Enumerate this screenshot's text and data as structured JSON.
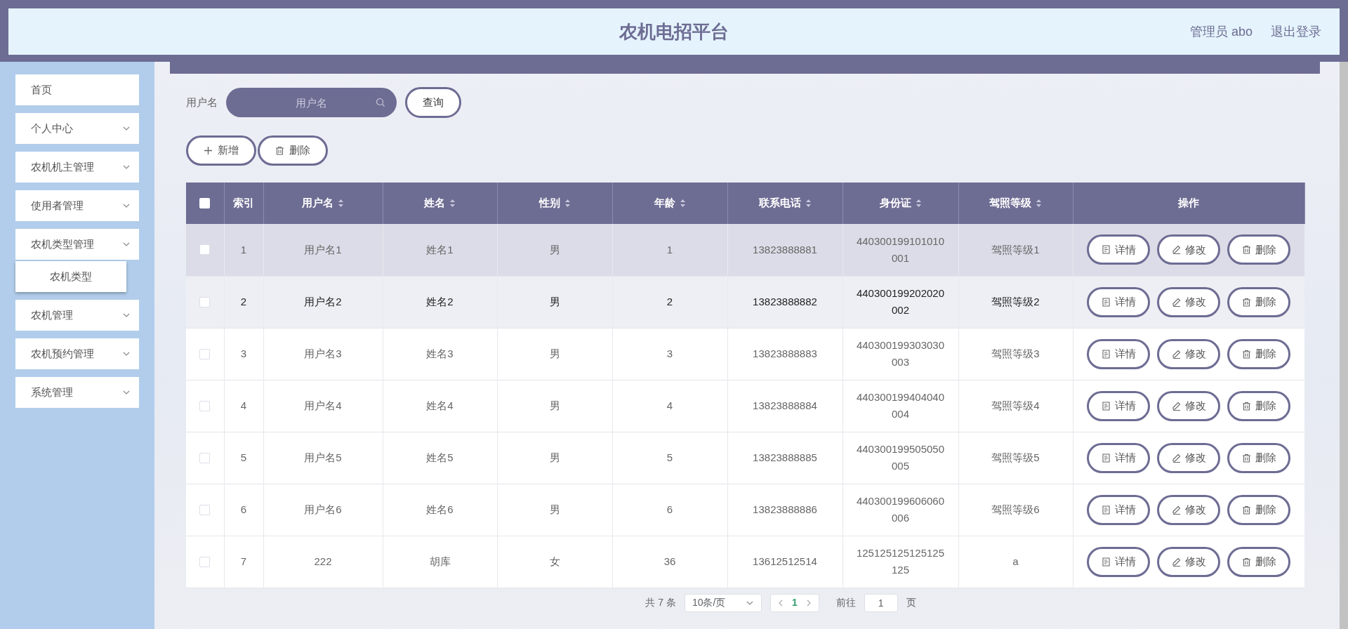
{
  "header": {
    "title": "农机电招平台",
    "user": "管理员 abo",
    "logout": "退出登录"
  },
  "sidebar": {
    "items": [
      {
        "label": "首页",
        "kind": "link"
      },
      {
        "label": "个人中心",
        "kind": "menu"
      },
      {
        "label": "农机机主管理",
        "kind": "menu"
      },
      {
        "label": "使用者管理",
        "kind": "menu"
      },
      {
        "label": "农机类型管理",
        "kind": "menu",
        "children": [
          {
            "label": "农机类型"
          }
        ]
      },
      {
        "label": "农机管理",
        "kind": "menu"
      },
      {
        "label": "农机预约管理",
        "kind": "menu"
      },
      {
        "label": "系统管理",
        "kind": "menu"
      }
    ]
  },
  "search": {
    "label": "用户名",
    "placeholder": "用户名",
    "button": "查询"
  },
  "actions": [
    {
      "label": "新增",
      "kind": "add"
    },
    {
      "label": "删除",
      "kind": "delete"
    }
  ],
  "table": {
    "columns": [
      {
        "label": "索引",
        "sortable": false
      },
      {
        "label": "用户名",
        "sortable": true
      },
      {
        "label": "姓名",
        "sortable": true
      },
      {
        "label": "性别",
        "sortable": true
      },
      {
        "label": "年龄",
        "sortable": true
      },
      {
        "label": "联系电话",
        "sortable": true
      },
      {
        "label": "身份证",
        "sortable": true
      },
      {
        "label": "驾照等级",
        "sortable": true
      },
      {
        "label": "操作",
        "sortable": false
      }
    ],
    "all_checked": false,
    "rows": [
      {
        "selected": true,
        "hovered": false,
        "checked": false,
        "cells": [
          "1",
          "用户名1",
          "姓名1",
          "男",
          "1",
          "13823888881",
          "440300199101010001",
          "驾照等级1"
        ],
        "actions": [
          {
            "label": "详情",
            "kind": "detail"
          },
          {
            "label": "修改",
            "kind": "edit"
          },
          {
            "label": "删除",
            "kind": "delete"
          }
        ]
      },
      {
        "selected": false,
        "hovered": true,
        "checked": false,
        "cells": [
          "2",
          "用户名2",
          "姓名2",
          "男",
          "2",
          "13823888882",
          "440300199202020002",
          "驾照等级2"
        ],
        "actions": [
          {
            "label": "详情",
            "kind": "detail"
          },
          {
            "label": "修改",
            "kind": "edit"
          },
          {
            "label": "删除",
            "kind": "delete"
          }
        ]
      },
      {
        "selected": false,
        "hovered": false,
        "checked": false,
        "cells": [
          "3",
          "用户名3",
          "姓名3",
          "男",
          "3",
          "13823888883",
          "440300199303030003",
          "驾照等级3"
        ],
        "actions": [
          {
            "label": "详情",
            "kind": "detail"
          },
          {
            "label": "修改",
            "kind": "edit"
          },
          {
            "label": "删除",
            "kind": "delete"
          }
        ]
      },
      {
        "selected": false,
        "hovered": false,
        "checked": false,
        "cells": [
          "4",
          "用户名4",
          "姓名4",
          "男",
          "4",
          "13823888884",
          "440300199404040004",
          "驾照等级4"
        ],
        "actions": [
          {
            "label": "详情",
            "kind": "detail"
          },
          {
            "label": "修改",
            "kind": "edit"
          },
          {
            "label": "删除",
            "kind": "delete"
          }
        ]
      },
      {
        "selected": false,
        "hovered": false,
        "checked": false,
        "cells": [
          "5",
          "用户名5",
          "姓名5",
          "男",
          "5",
          "13823888885",
          "440300199505050005",
          "驾照等级5"
        ],
        "actions": [
          {
            "label": "详情",
            "kind": "detail"
          },
          {
            "label": "修改",
            "kind": "edit"
          },
          {
            "label": "删除",
            "kind": "delete"
          }
        ]
      },
      {
        "selected": false,
        "hovered": false,
        "checked": false,
        "cells": [
          "6",
          "用户名6",
          "姓名6",
          "男",
          "6",
          "13823888886",
          "440300199606060006",
          "驾照等级6"
        ],
        "actions": [
          {
            "label": "详情",
            "kind": "detail"
          },
          {
            "label": "修改",
            "kind": "edit"
          },
          {
            "label": "删除",
            "kind": "delete"
          }
        ]
      },
      {
        "selected": false,
        "hovered": false,
        "checked": false,
        "cells": [
          "7",
          "222",
          "胡库",
          "女",
          "36",
          "13612512514",
          "125125125125125125",
          "a"
        ],
        "actions": [
          {
            "label": "详情",
            "kind": "detail"
          },
          {
            "label": "修改",
            "kind": "edit"
          },
          {
            "label": "删除",
            "kind": "delete"
          }
        ]
      }
    ]
  },
  "pagination": {
    "total": "共 7 条",
    "page_size": "10条/页",
    "pages": [
      {
        "label": "1",
        "selected": true
      }
    ],
    "goto_label": "前往",
    "goto_value": "1",
    "goto_unit": "页"
  }
}
